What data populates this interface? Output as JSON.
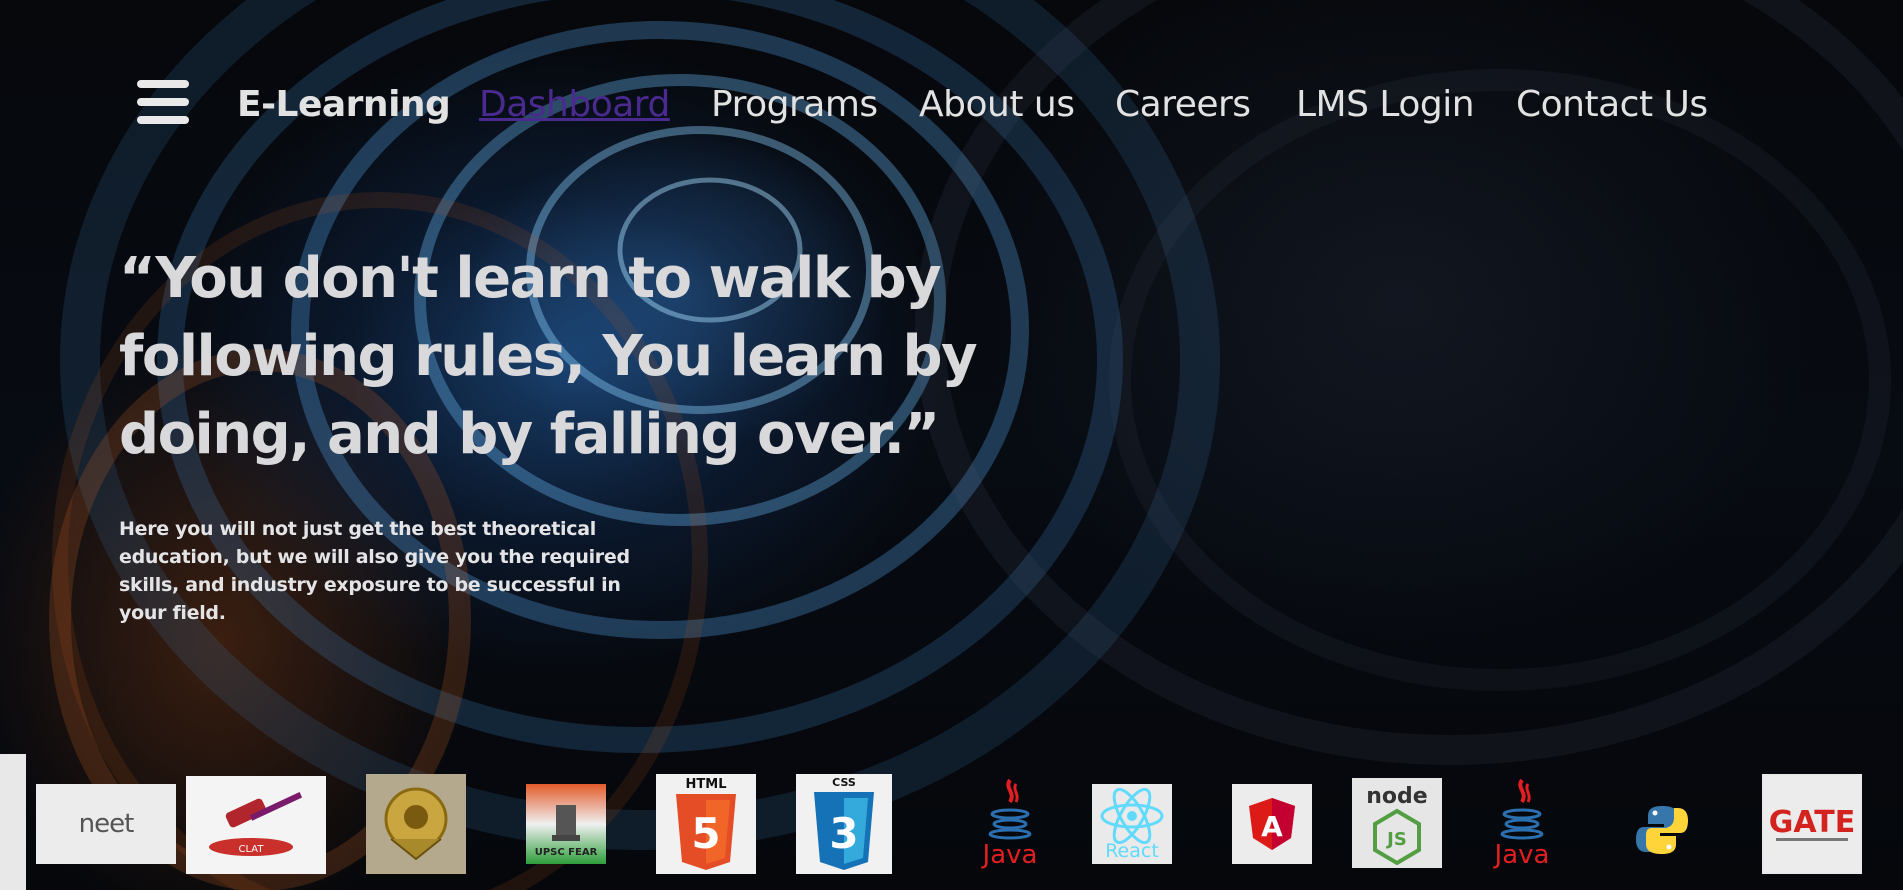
{
  "nav": {
    "brand": "E-Learning",
    "items": [
      "Dashboard",
      "Programs",
      "About us",
      "Careers",
      "LMS Login",
      "Contact Us"
    ]
  },
  "hero": {
    "quote": "“You don't learn to walk by following rules, You learn by doing, and by falling over.”",
    "description": "Here you will not just get the best theoretical education, but we will also give you the required skills, and industry exposure to be successful in your field."
  },
  "logos": {
    "neet": "neet",
    "clat": "CLAT",
    "upsc": "UPSC FEAR",
    "html": "HTML",
    "html_num": "5",
    "css": "CSS",
    "css_num": "3",
    "java1": "Java",
    "react": "React",
    "angular": "A",
    "node": "node",
    "node_js": "JS",
    "java2": "Java",
    "gate": "GATE"
  },
  "colors": {
    "active_link": "#4a2a8f",
    "nav_text": "#e2e2e2",
    "html_orange": "#e44d26",
    "css_blue": "#1572b6",
    "java_red": "#e11f21",
    "react_cyan": "#61dafb",
    "angular_red": "#dd1b16",
    "node_green": "#539e43"
  }
}
